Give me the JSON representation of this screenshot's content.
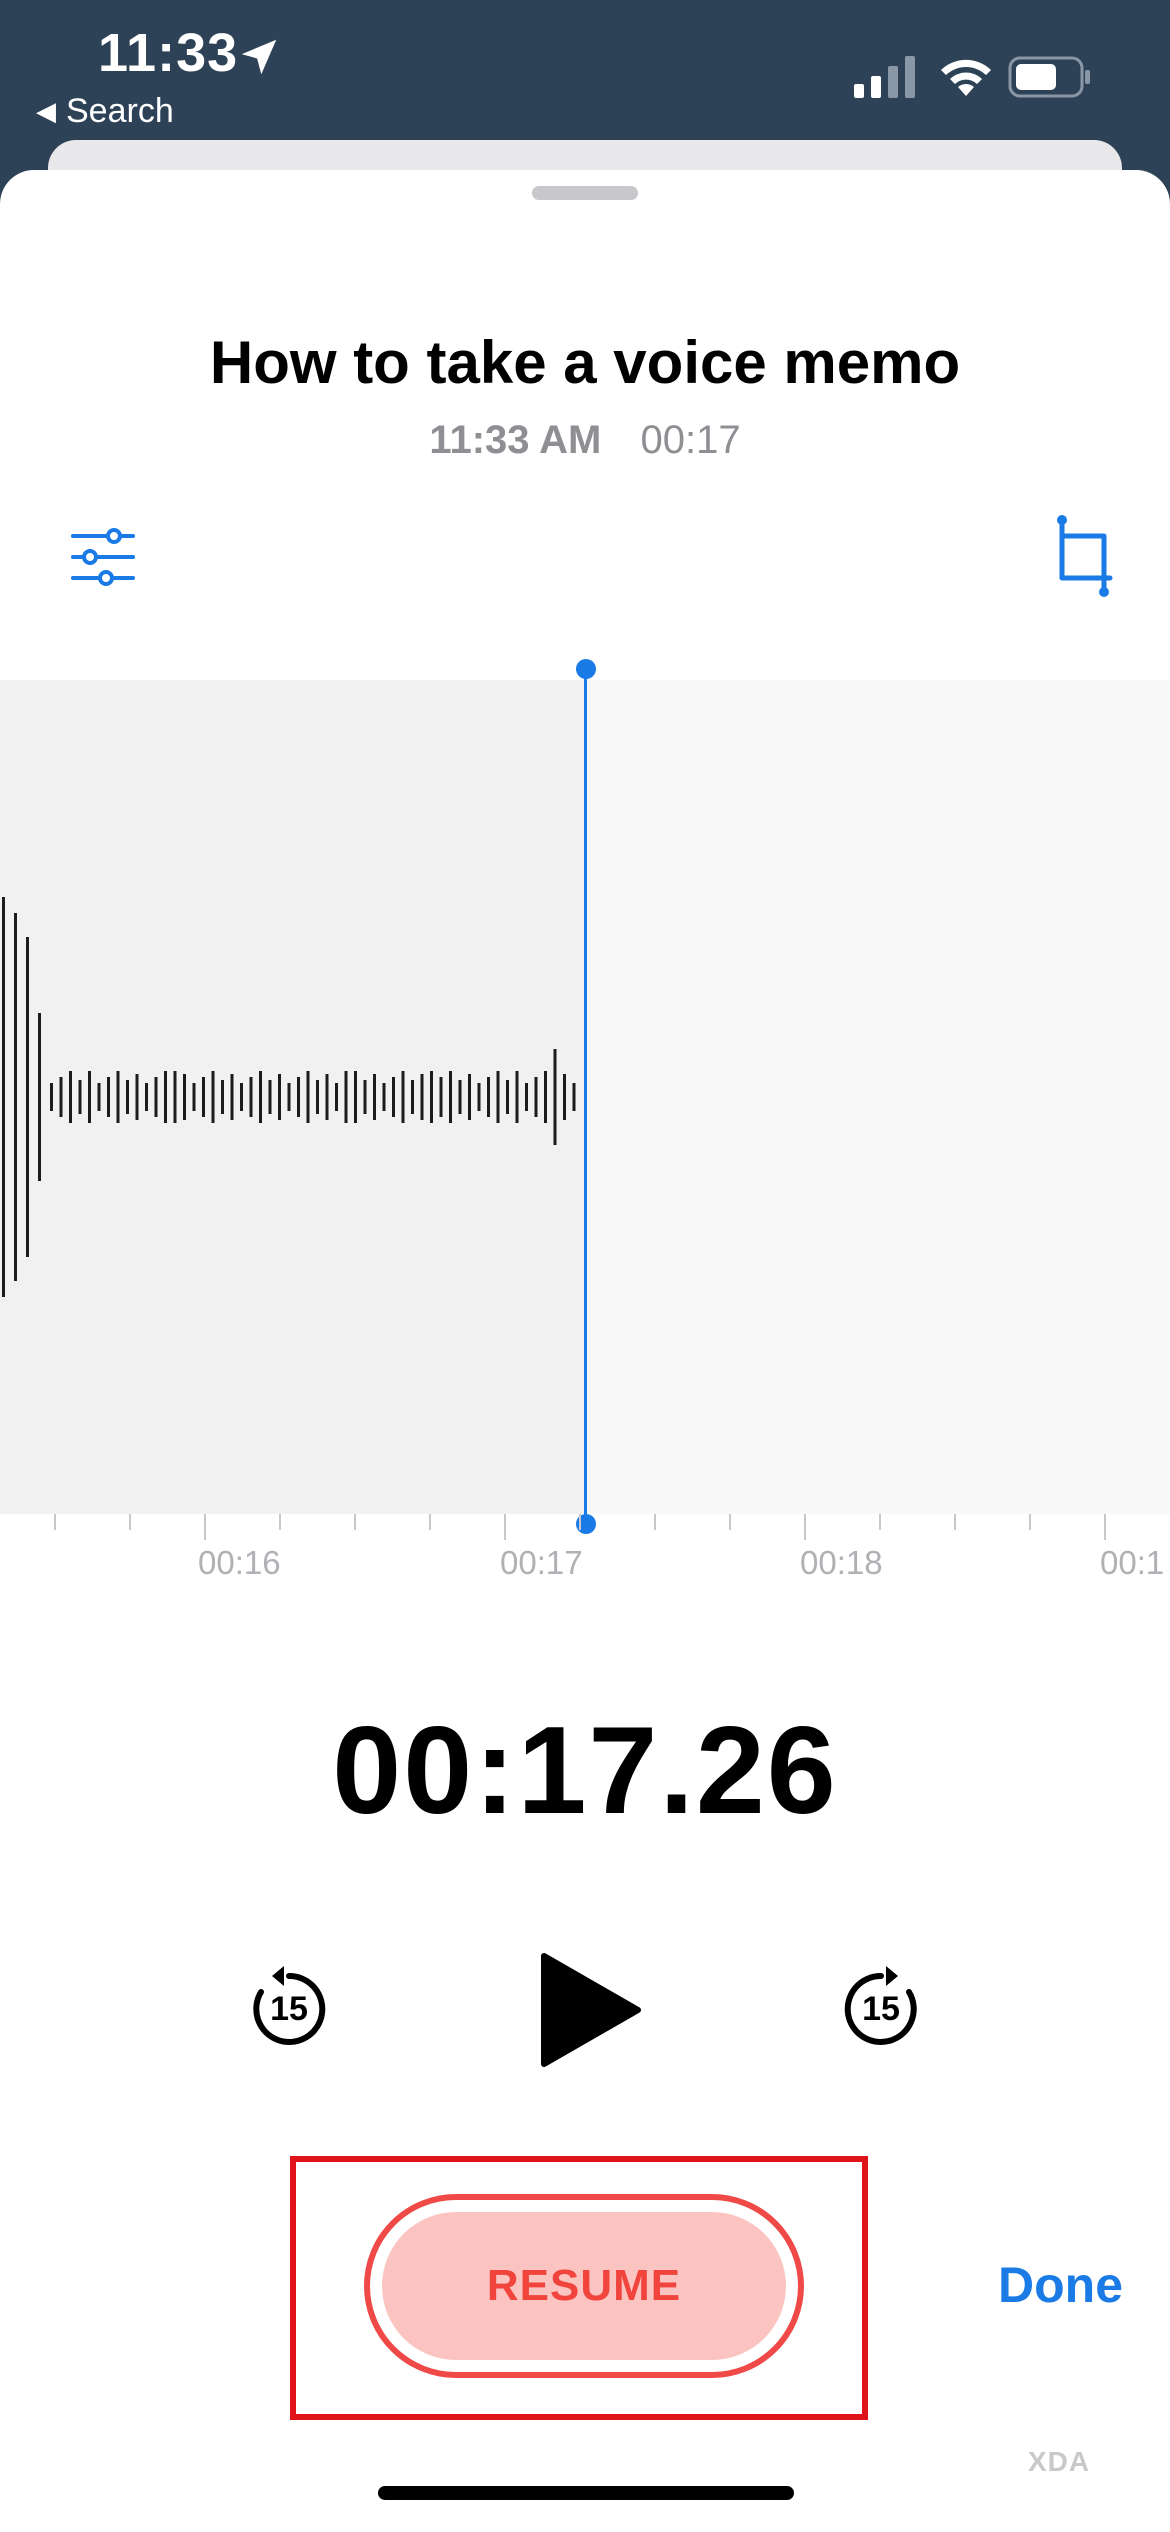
{
  "status_bar": {
    "time": "11:33",
    "back_label": "Search",
    "icons": [
      "location-arrow-icon",
      "cellular-signal-icon",
      "wifi-icon",
      "battery-icon"
    ]
  },
  "memo": {
    "title": "How to take a voice memo",
    "recorded_time": "11:33 AM",
    "duration": "00:17"
  },
  "toolbar": {
    "left_icon": "settings-sliders-icon",
    "right_icon": "trim-crop-icon"
  },
  "timeline": {
    "tick_labels": [
      "00:16",
      "00:17",
      "00:18",
      "00:1"
    ]
  },
  "player": {
    "elapsed": "00:17.26",
    "skip_back_seconds": "15",
    "skip_forward_seconds": "15"
  },
  "actions": {
    "resume_label": "RESUME",
    "done_label": "Done"
  },
  "watermark": "XDA",
  "colors": {
    "accent": "#1a7ae6",
    "resume_text": "#f0443c",
    "resume_fill": "#fbc4c0",
    "highlight": "#e0131a",
    "header_bg": "#2e4257"
  }
}
